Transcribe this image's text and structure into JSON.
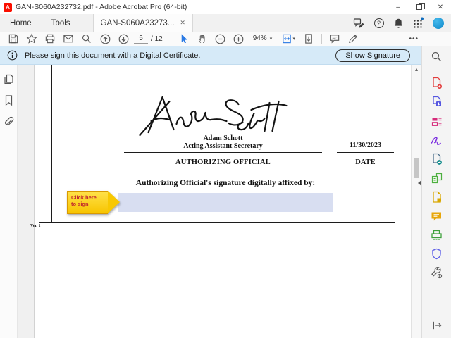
{
  "window": {
    "title": "GAN-S060A232732.pdf - Adobe Acrobat Pro (64-bit)"
  },
  "tabs": {
    "home": "Home",
    "tools": "Tools",
    "document": "GAN-S060A23273...",
    "close_glyph": "✕"
  },
  "toolbar": {
    "page_current": "5",
    "page_total": "/ 12",
    "zoom_level": "94%"
  },
  "notification": {
    "message": "Please sign this document with a Digital Certificate.",
    "button_label": "Show Signature"
  },
  "document": {
    "signatory_name": "Adam Schott",
    "signatory_title": "Acting Assistant Secretary",
    "role_label": "AUTHORIZING OFFICIAL",
    "date_value": "11/30/2023",
    "date_label": "DATE",
    "affix_label": "Authorizing Official's signature digitally affixed by:",
    "version_label": "Ver. 1",
    "sign_tag_line1": "Click here",
    "sign_tag_line2": "to sign"
  },
  "icons": {
    "minimize_glyph": "–",
    "close_glyph": "✕",
    "help_glyph": "?",
    "caret_glyph": "▾",
    "more_glyph": "•••",
    "scroll_up_glyph": "▴"
  },
  "colors": {
    "accent_blue": "#2a7ae4",
    "notif_bg": "#d6eaf8",
    "field_bg": "#d8def1",
    "tag_yellow": "#f7c400",
    "tag_text": "#c1272d",
    "acrobat_red": "#fa0f00"
  }
}
